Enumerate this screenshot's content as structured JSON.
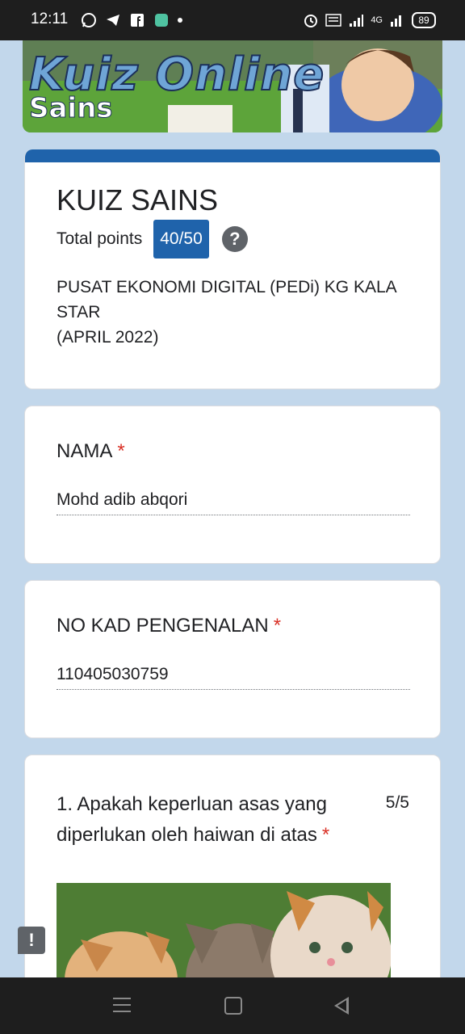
{
  "status_bar": {
    "time": "12:11",
    "network_label": "4G",
    "battery": "89",
    "icons_left": [
      "whatsapp-icon",
      "telegram-icon",
      "facebook-icon",
      "app-icon",
      "dot-icon"
    ],
    "icons_right": [
      "alarm-icon",
      "volte-icon",
      "signal-icon",
      "signal-4g-icon",
      "battery-icon"
    ]
  },
  "banner": {
    "title": "Kuiz Online",
    "subtitle": "Sains"
  },
  "form": {
    "title": "KUIZ SAINS",
    "points_label": "Total points",
    "points_value": "40/50",
    "help": "?",
    "description": "PUSAT EKONOMI DIGITAL (PEDi) KG KALA STAR\n(APRIL 2022)",
    "accent_color": "#1f63ab"
  },
  "questions": [
    {
      "label": "NAMA",
      "required": "*",
      "answer": "Mohd adib abqori"
    },
    {
      "label": "NO KAD PENGENALAN",
      "required": "*",
      "answer": "110405030759"
    },
    {
      "label": "1. Apakah keperluan asas yang diperlukan oleh haiwan di atas",
      "required": "*",
      "score": "5/5"
    }
  ],
  "feedback_icon": "!"
}
